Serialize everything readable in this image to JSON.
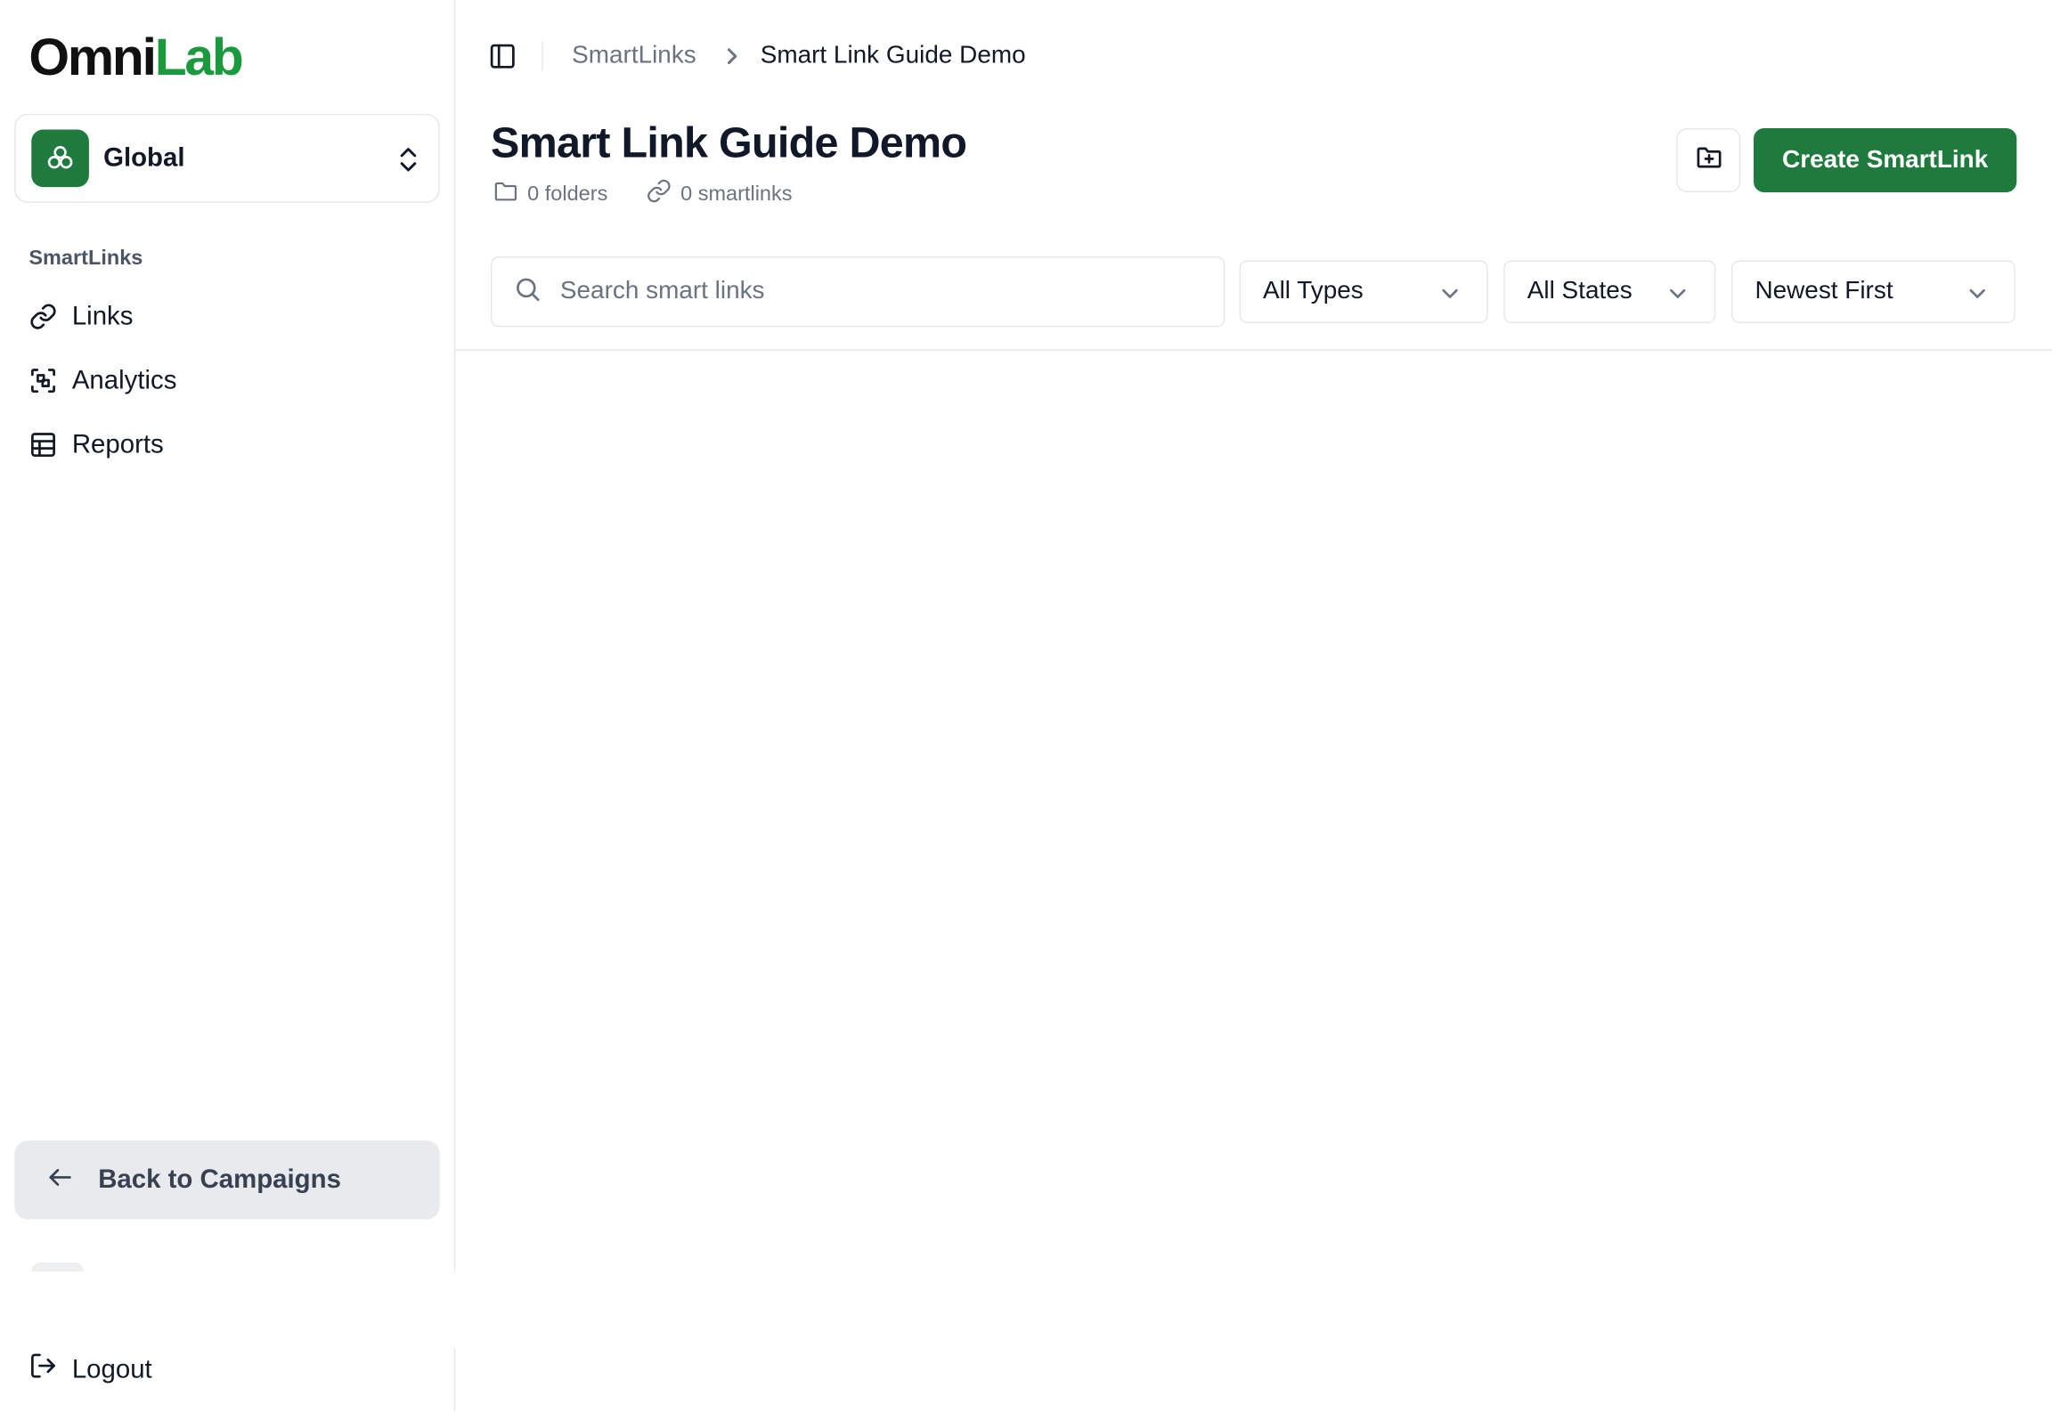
{
  "brand": {
    "logo_part1": "Omni",
    "logo_part2": "Lab",
    "accent": "#1f7a3e"
  },
  "workspace": {
    "name": "Global",
    "icon": "clover-icon"
  },
  "sidebar": {
    "section_label": "SmartLinks",
    "items": [
      {
        "label": "Links",
        "icon": "link-icon"
      },
      {
        "label": "Analytics",
        "icon": "scan-icon"
      },
      {
        "label": "Reports",
        "icon": "table-icon"
      }
    ],
    "back_label": "Back to Campaigns",
    "logout_label": "Logout"
  },
  "breadcrumb": {
    "parent": "SmartLinks",
    "current": "Smart Link Guide Demo"
  },
  "page": {
    "title": "Smart Link Guide Demo",
    "folders_count": "0 folders",
    "smartlinks_count": "0 smartlinks"
  },
  "actions": {
    "create_label": "Create SmartLink",
    "new_folder_icon": "folder-plus-icon"
  },
  "filters": {
    "search_placeholder": "Search smart links",
    "type": "All Types",
    "state": "All States",
    "sort": "Newest First"
  }
}
